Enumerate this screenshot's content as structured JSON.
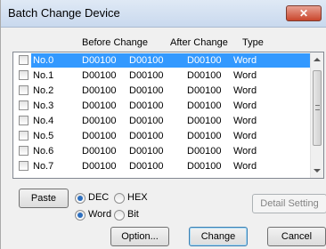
{
  "window": {
    "title": "Batch Change Device",
    "close_label": "✕"
  },
  "columns": [
    "Before Change",
    "After Change",
    "Type"
  ],
  "rows": [
    {
      "no": "No.0",
      "b1": "D00100",
      "b2": "D00100",
      "after": "D00100",
      "type": "Word",
      "selected": true
    },
    {
      "no": "No.1",
      "b1": "D00100",
      "b2": "D00100",
      "after": "D00100",
      "type": "Word"
    },
    {
      "no": "No.2",
      "b1": "D00100",
      "b2": "D00100",
      "after": "D00100",
      "type": "Word"
    },
    {
      "no": "No.3",
      "b1": "D00100",
      "b2": "D00100",
      "after": "D00100",
      "type": "Word"
    },
    {
      "no": "No.4",
      "b1": "D00100",
      "b2": "D00100",
      "after": "D00100",
      "type": "Word"
    },
    {
      "no": "No.5",
      "b1": "D00100",
      "b2": "D00100",
      "after": "D00100",
      "type": "Word"
    },
    {
      "no": "No.6",
      "b1": "D00100",
      "b2": "D00100",
      "after": "D00100",
      "type": "Word"
    },
    {
      "no": "No.7",
      "b1": "D00100",
      "b2": "D00100",
      "after": "D00100",
      "type": "Word"
    }
  ],
  "buttons": {
    "paste": "Paste",
    "detail_setting": "Detail Setting",
    "option": "Option...",
    "change": "Change",
    "cancel": "Cancel"
  },
  "radio_format": {
    "options": [
      "DEC",
      "HEX"
    ],
    "selected": "DEC"
  },
  "radio_size": {
    "options": [
      "Word",
      "Bit"
    ],
    "selected": "Word"
  },
  "colors": {
    "selection": "#3399ff",
    "close_button": "#c9462c"
  }
}
